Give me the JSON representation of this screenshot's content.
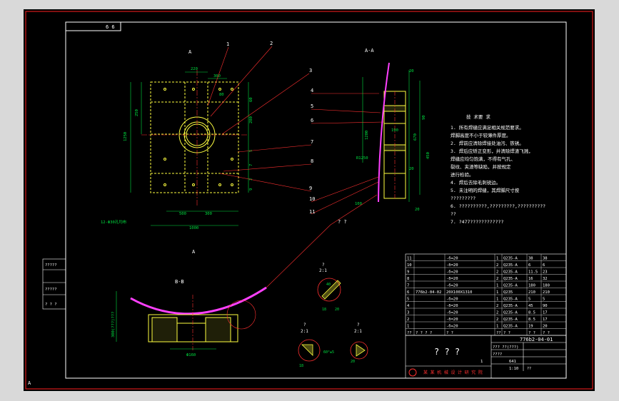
{
  "colors": {
    "frame": "#ff2020",
    "geom": "#ffff40",
    "dim": "#00e040",
    "title": "#ffffff",
    "leader": "#ff3030",
    "magenta": "#ff40ff",
    "cyan": "#40ffff"
  },
  "corner": {
    "code": "6 6",
    "corner_a": "A"
  },
  "views": {
    "a_view": "A",
    "section_aa": "A-A",
    "section_bb": "B-B",
    "b_mark": "A"
  },
  "plan_dims": {
    "d220": "220",
    "d300": "300",
    "d80": "80",
    "d1250": "1250",
    "d250": "250",
    "d60": "60",
    "d280": "280",
    "d5": "5",
    "d7": "7",
    "d2": "2",
    "d9": "9",
    "d500": "500",
    "d300b": "300",
    "d1000": "1000",
    "hole": "12-Ф30孔均布"
  },
  "callouts": [
    "1",
    "2",
    "3",
    "4",
    "5",
    "6",
    "7",
    "8",
    "9",
    "10",
    "11"
  ],
  "section_dims": {
    "s20a": "20",
    "s90": "90",
    "s190": "190",
    "s1200": "1200",
    "s670": "670",
    "s450": "450",
    "sR1250": "R1250",
    "s20b": "20",
    "s20c": "20",
    "s100": "100"
  },
  "notes": {
    "title": "技 术要 求",
    "lines": [
      "1. 所有焊缝应满足相关规范要求。",
      "   焊脚高度不小于较薄件厚度。",
      "2. 焊前应清除焊接处油污、铁锈。",
      "3. 焊后应矫正变形，并清除焊渣飞溅，",
      "   焊缝应均匀饱满，不得有气孔、",
      "   裂纹、夹渣等缺陷，并按规定",
      "   进行检验。",
      "4. 焊后去除毛刺锐边。",
      "5. 未注明的焊缝，其焊脚尺寸按",
      "   ?????????",
      "6. ??????????,?????????,??????????",
      "   ??",
      "7. ?477????????????"
    ]
  },
  "leader_label": "? ?",
  "bb_dims": {
    "left": "300(???)???",
    "bottom": "Ф160"
  },
  "details": {
    "d1": "?",
    "d1b": "2:1",
    "d2": "?",
    "d2b": "2:1",
    "d3": "?",
    "d3b": "2:1",
    "d1_dim": "40",
    "d1_dim2": "18",
    "d1_dim3": "20",
    "d2_dim": "60°±5",
    "d2_dim2": "18",
    "d3_dim": "20"
  },
  "left_block": {
    "l1": "?????",
    "l2": "?????",
    "l3": "? ? ?"
  },
  "bom": {
    "rows": [
      [
        "11",
        "",
        "-δ=20",
        "1",
        "Q235-A",
        "38",
        "38"
      ],
      [
        "10",
        "",
        "-δ=20",
        "2",
        "Q235-A",
        "6",
        "6"
      ],
      [
        "9",
        "",
        "-δ=20",
        "2",
        "Q235-A",
        "11.5",
        "23"
      ],
      [
        "8",
        "",
        "-δ=20",
        "2",
        "Q235-A",
        "16",
        "32"
      ],
      [
        "7",
        "",
        "-δ=20",
        "1",
        "Q235-A",
        "180",
        "180"
      ],
      [
        "6",
        "776b2-04-02",
        "20X100X1310",
        "1",
        "Q235",
        "210",
        "210"
      ],
      [
        "5",
        "",
        "-δ=20",
        "1",
        "Q235-A",
        "5",
        "5"
      ],
      [
        "4",
        "",
        "-δ=20",
        "2",
        "Q235-A",
        "45",
        "90"
      ],
      [
        "3",
        "",
        "-δ=20",
        "2",
        "Q235-A",
        "8.5",
        "17"
      ],
      [
        "2",
        "",
        "-δ=20",
        "2",
        "Q235-A",
        "8.5",
        "17"
      ],
      [
        "1",
        "",
        "-δ=20",
        "1",
        "Q235-A",
        "19",
        "20"
      ]
    ],
    "header": [
      "??",
      "? ? ? ?",
      "? ?",
      "??",
      "? ?",
      "? ?",
      "? ?"
    ]
  },
  "title_block": {
    "dwg_no": "776b2-04-01",
    "name": "? ? ?",
    "material": "??? ??(???)",
    "scale": "1:10",
    "weight": "641",
    "qty": "1",
    "units": "????",
    "company": "某 某 机 械 设 计 研 究 院",
    "sheet": "??"
  }
}
